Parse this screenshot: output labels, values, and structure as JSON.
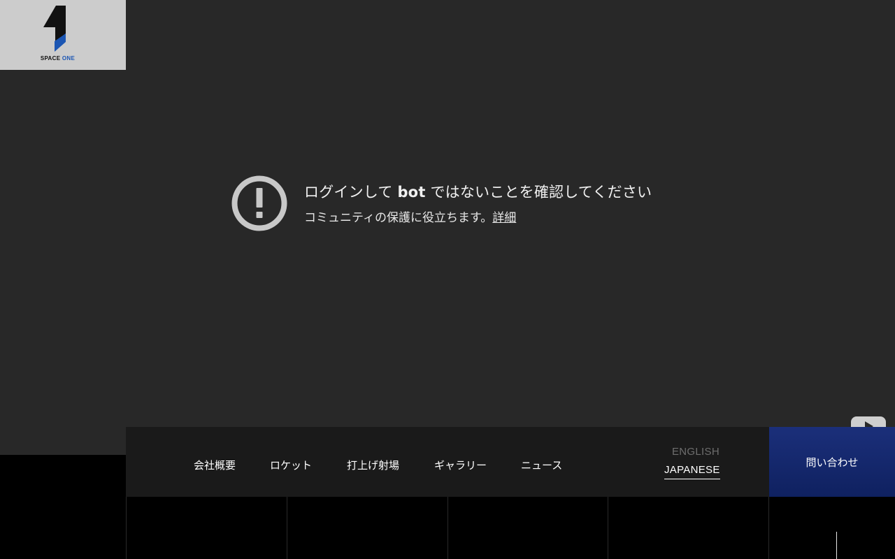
{
  "logo": {
    "text_main": "SPACE",
    "text_accent": "ONE",
    "colors": {
      "dark": "#111111",
      "accent": "#1c56b3",
      "background": "#cccccc"
    }
  },
  "video": {
    "background": "#282828",
    "warning_icon": "exclamation-circle-icon",
    "title_before": "ログインして ",
    "title_bold": "bot",
    "title_after": " ではないことを確認してください",
    "subtitle": "コミュニティの保護に役立ちます。",
    "learn_more": "詳細",
    "corner_icon": "youtube-logo-icon"
  },
  "nav": {
    "items": [
      {
        "label": "会社概要"
      },
      {
        "label": "ロケット"
      },
      {
        "label": "打上げ射場"
      },
      {
        "label": "ギャラリー"
      },
      {
        "label": "ニュース"
      }
    ],
    "languages": {
      "english": "ENGLISH",
      "japanese": "JAPANESE",
      "selected": "JAPANESE"
    },
    "contact_label": "問い合わせ",
    "contact_color": "#1b2f7a"
  }
}
